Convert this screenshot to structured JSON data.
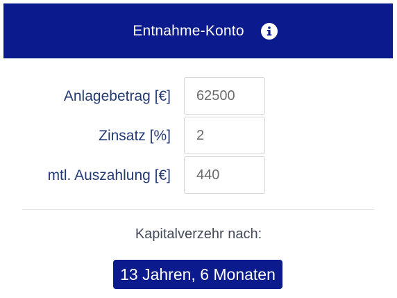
{
  "header": {
    "title": "Entnahme-Konto",
    "info_icon": "info-icon",
    "background_color": "#0b1a8c"
  },
  "form": {
    "fields": [
      {
        "label": "Anlagebetrag [€]",
        "value": "62500"
      },
      {
        "label": "Zinsatz [%]",
        "value": "2"
      },
      {
        "label": "mtl. Auszahlung [€]",
        "value": "440"
      }
    ]
  },
  "result": {
    "label": "Kapitalverzehr nach:",
    "value": "13 Jahren, 6 Monaten",
    "background_color": "#0b1a8c"
  },
  "colors": {
    "label_text": "#233a75",
    "input_text": "#6b6b6b"
  }
}
